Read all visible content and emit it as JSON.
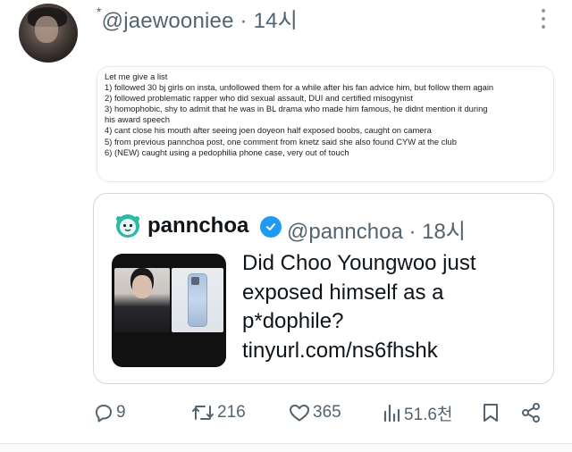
{
  "tweet": {
    "author_handle": "@jaewooniee",
    "separator": "·",
    "time": "14시",
    "avatar_icon": "user-avatar",
    "more_icon": "more-vertical-icon",
    "text_lines": [
      "Let me give a list",
      "1) followed 30 bj girls on insta, unfollowed them for a while after his fan advice him, but follow them again",
      "2) followed problematic rapper who did sexual assault, DUI and certified misogynist",
      "3) homophobic, shy to admit that he was in BL drama who made him famous, he didnt mention it during",
      "his award speech",
      "4) cant close his mouth after seeing joen doyeon half exposed boobs, caught on camera",
      "5) from previous pannchoa post, one comment from knetz said she also found CYW at the club",
      "6) (NEW) caught using a pedophilia phone case, very out of touch"
    ]
  },
  "quote": {
    "name": "pannchoa",
    "handle": "@pannchoa",
    "separator": "·",
    "time": "18시",
    "verified_icon": "verified-badge-icon",
    "text_lines": [
      "Did Choo Youngwoo just",
      "exposed himself as a",
      "p*dophile?",
      "tinyurl.com/ns6fhshk"
    ]
  },
  "actions": {
    "replies": "9",
    "retweets": "216",
    "likes": "365",
    "views": "51.6천",
    "reply_icon": "reply-icon",
    "retweet_icon": "retweet-icon",
    "like_icon": "heart-icon",
    "views_icon": "views-icon",
    "bookmark_icon": "bookmark-icon",
    "share_icon": "share-icon"
  },
  "colors": {
    "muted_text": "#536471",
    "verified_blue": "#1d9bf0",
    "border": "#cfd9de"
  }
}
